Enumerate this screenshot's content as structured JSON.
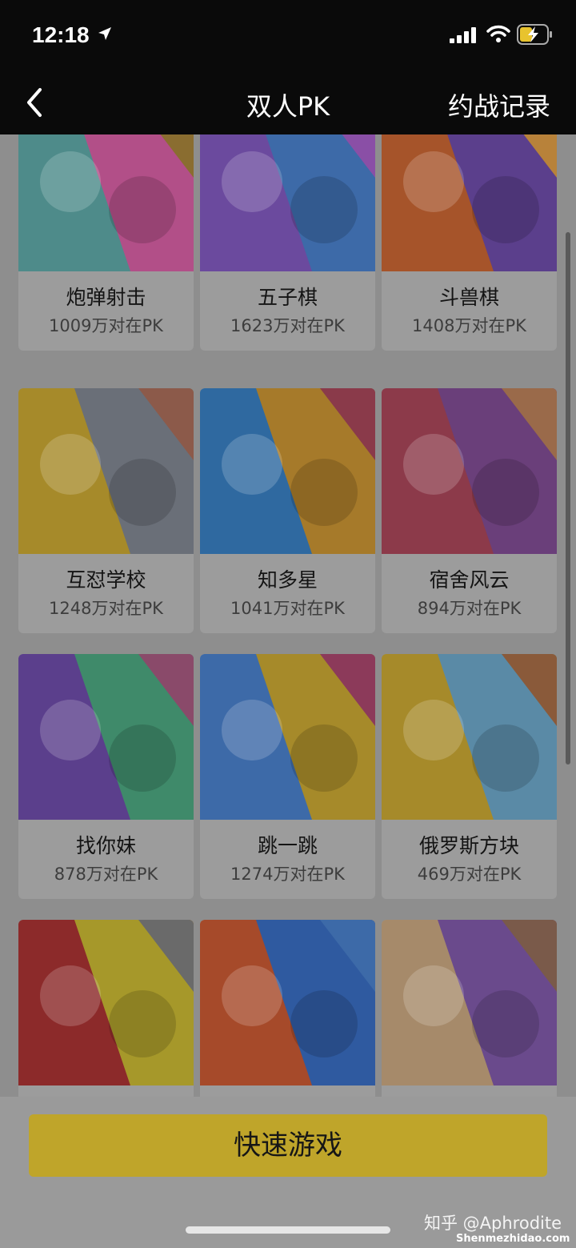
{
  "status": {
    "time": "12:18"
  },
  "nav": {
    "title": "双人PK",
    "history": "约战记录"
  },
  "games": [
    {
      "name": "炮弹射击",
      "count": "1009万对在PK",
      "colors": [
        "#4e8b8a",
        "#b24f88",
        "#8a6d30"
      ]
    },
    {
      "name": "五子棋",
      "count": "1623万对在PK",
      "colors": [
        "#6b4a9e",
        "#3d6aa8",
        "#8a4fa6"
      ]
    },
    {
      "name": "斗兽棋",
      "count": "1408万对在PK",
      "colors": [
        "#a6542a",
        "#5b3f8c",
        "#b8823a"
      ]
    },
    {
      "name": "互怼学校",
      "count": "1248万对在PK",
      "colors": [
        "#a68a2a",
        "#6a6f78",
        "#8c5a4a"
      ]
    },
    {
      "name": "知多星",
      "count": "1041万对在PK",
      "colors": [
        "#2f69a0",
        "#a67a2a",
        "#8a3a4a"
      ]
    },
    {
      "name": "宿舍风云",
      "count": "894万对在PK",
      "colors": [
        "#8c3a4a",
        "#6a3f7a",
        "#9a6a4a"
      ]
    },
    {
      "name": "找你妹",
      "count": "878万对在PK",
      "colors": [
        "#5b3f8c",
        "#3f8a6a",
        "#8a4a6a"
      ]
    },
    {
      "name": "跳一跳",
      "count": "1274万对在PK",
      "colors": [
        "#3d6aa8",
        "#a68a2a",
        "#8c3a5a"
      ]
    },
    {
      "name": "俄罗斯方块",
      "count": "469万对在PK",
      "colors": [
        "#a68a2a",
        "#5a8aa6",
        "#8a5a3a"
      ]
    },
    {
      "name": "",
      "count": "",
      "colors": [
        "#8c2a2a",
        "#a6982a",
        "#6a6a6a"
      ]
    },
    {
      "name": "",
      "count": "",
      "colors": [
        "#a64a2a",
        "#2f5aa0",
        "#3d6aa8"
      ]
    },
    {
      "name": "",
      "count": "",
      "colors": [
        "#a68a6a",
        "#6a4a8c",
        "#7a5a4a"
      ]
    }
  ],
  "quick_button": "快速游戏",
  "watermark": "知乎 @Aphrodite",
  "watermark2": "Shenmezhidao.com"
}
